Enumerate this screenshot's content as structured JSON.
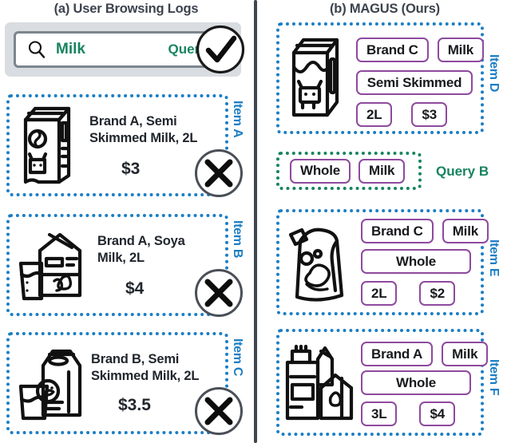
{
  "panels": {
    "left": {
      "title": "(a) User Browsing Logs",
      "query": {
        "term": "Milk",
        "label": "Query A",
        "icon": "search-icon",
        "verdict": "check"
      },
      "items": [
        {
          "side_label": "Item A",
          "description": "Brand A, Semi Skimmed Milk, 2L",
          "description_line1": "Brand A, Semi",
          "description_line2": "Skimmed Milk, 2L",
          "price": "$3",
          "verdict": "cross",
          "icon": "milk-carton-cow-icon"
        },
        {
          "side_label": "Item B",
          "description": "Brand A, Soya Milk, 2L",
          "description_line1": "Brand A, Soya",
          "description_line2": "Milk, 2L",
          "price": "$4",
          "verdict": "cross",
          "icon": "soya-milk-glass-icon"
        },
        {
          "side_label": "Item C",
          "description": "Brand B, Semi Skimmed Milk, 2L",
          "description_line1": "Brand B, Semi",
          "description_line2": "Skimmed Milk, 2L",
          "price": "$3.5",
          "verdict": "cross",
          "icon": "milk-carton-glass-icon"
        }
      ]
    },
    "right": {
      "title": "(b) MAGUS (Ours)",
      "query": {
        "label": "Query B",
        "tags": [
          "Whole",
          "Milk"
        ]
      },
      "items": [
        {
          "side_label": "Item D",
          "icon": "milk-carton-cow-icon",
          "tags_row1": [
            "Brand C",
            "Milk"
          ],
          "tags_row2": [
            "Semi Skimmed"
          ],
          "tags_row3": [
            "2L",
            "$3"
          ]
        },
        {
          "side_label": "Item E",
          "icon": "milk-powder-bag-icon",
          "tags_row1": [
            "Brand C",
            "Milk"
          ],
          "tags_row2": [
            "Whole"
          ],
          "tags_row3": [
            "2L",
            "$2"
          ]
        },
        {
          "side_label": "Item F",
          "icon": "milk-bottle-carton-icon",
          "tags_row1": [
            "Brand A",
            "Milk"
          ],
          "tags_row2": [
            "Whole"
          ],
          "tags_row3": [
            "3L",
            "$4"
          ]
        }
      ]
    }
  },
  "colors": {
    "dotted_blue": "#1b7ec4",
    "query_green": "#17845f",
    "tag_purple": "#8e4a9e",
    "divider_slate": "#3f4650",
    "title_gray": "#3c434d"
  }
}
